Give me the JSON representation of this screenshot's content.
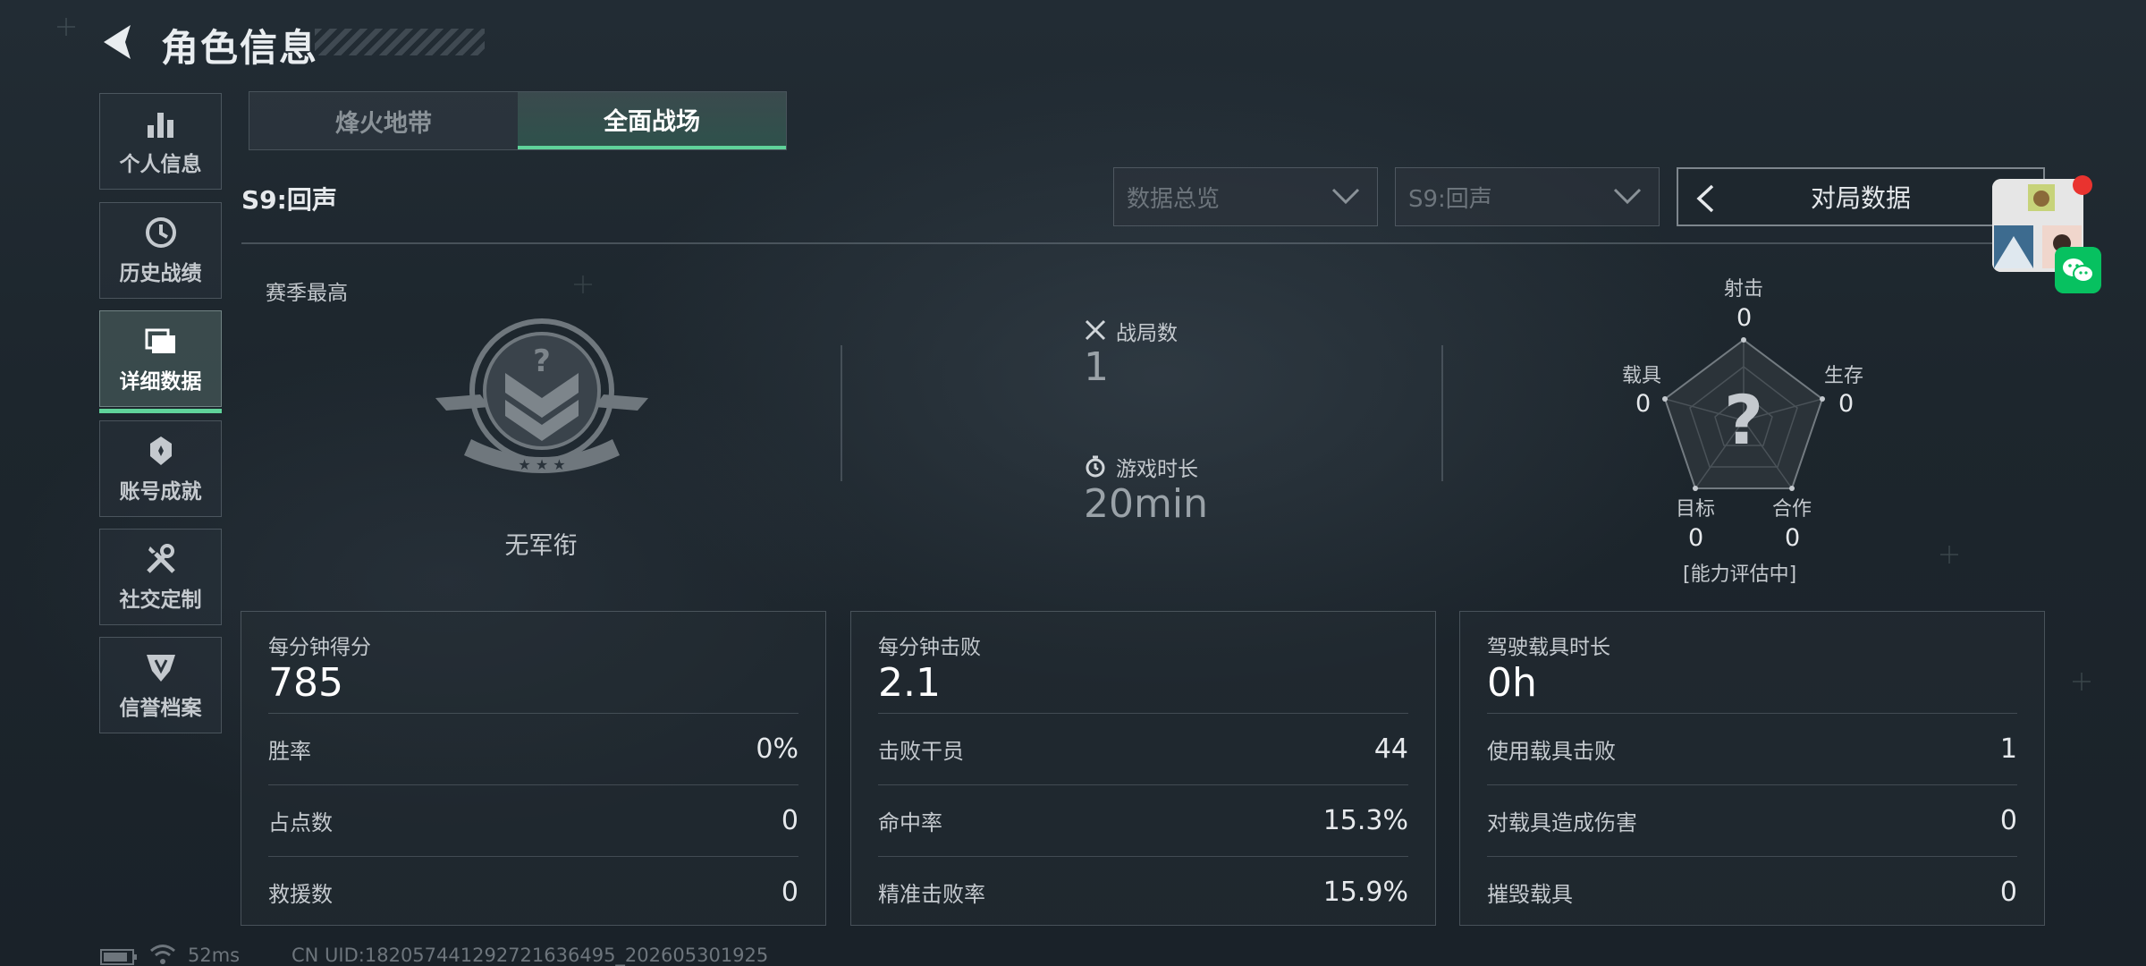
{
  "header": {
    "title": "角色信息"
  },
  "sidebar": {
    "items": [
      {
        "label": "个人信息",
        "icon": "bar-chart-icon"
      },
      {
        "label": "历史战绩",
        "icon": "clock-icon"
      },
      {
        "label": "详细数据",
        "icon": "cards-icon",
        "active": true
      },
      {
        "label": "账号成就",
        "icon": "medal-icon"
      },
      {
        "label": "社交定制",
        "icon": "tools-icon"
      },
      {
        "label": "信誉档案",
        "icon": "shield-icon"
      }
    ]
  },
  "mode_tabs": [
    {
      "label": "烽火地带",
      "active": false
    },
    {
      "label": "全面战场",
      "active": true
    }
  ],
  "season_label": "S9:回声",
  "filters": {
    "data_type": "数据总览",
    "season": "S9:回声",
    "match_data": "对局数据"
  },
  "season_best": {
    "label": "赛季最高",
    "rank_name": "无军衔"
  },
  "summary": {
    "matches_label": "战局数",
    "matches_value": "1",
    "playtime_label": "游戏时长",
    "playtime_value": "20min"
  },
  "radar": {
    "axes": [
      {
        "label": "射击",
        "value": "0"
      },
      {
        "label": "生存",
        "value": "0"
      },
      {
        "label": "合作",
        "value": "0"
      },
      {
        "label": "目标",
        "value": "0"
      },
      {
        "label": "载具",
        "value": "0"
      }
    ],
    "center_symbol": "?",
    "status": "[能力评估中]"
  },
  "panels": [
    {
      "title": "每分钟得分",
      "value": "785",
      "rows": [
        {
          "label": "胜率",
          "value": "0%"
        },
        {
          "label": "占点数",
          "value": "0"
        },
        {
          "label": "救援数",
          "value": "0"
        }
      ]
    },
    {
      "title": "每分钟击败",
      "value": "2.1",
      "rows": [
        {
          "label": "击败干员",
          "value": "44"
        },
        {
          "label": "命中率",
          "value": "15.3%"
        },
        {
          "label": "精准击败率",
          "value": "15.9%"
        }
      ]
    },
    {
      "title": "驾驶载具时长",
      "value": "0h",
      "rows": [
        {
          "label": "使用载具击败",
          "value": "1"
        },
        {
          "label": "对载具造成伤害",
          "value": "0"
        },
        {
          "label": "摧毁载具",
          "value": "0"
        }
      ]
    }
  ],
  "footer": {
    "ping": "52ms",
    "uid": "CN UID:1820574412927216364​95_202605301925"
  },
  "colors": {
    "accent": "#5fd39a",
    "notify": "#e9332f",
    "wechat": "#07c160"
  }
}
